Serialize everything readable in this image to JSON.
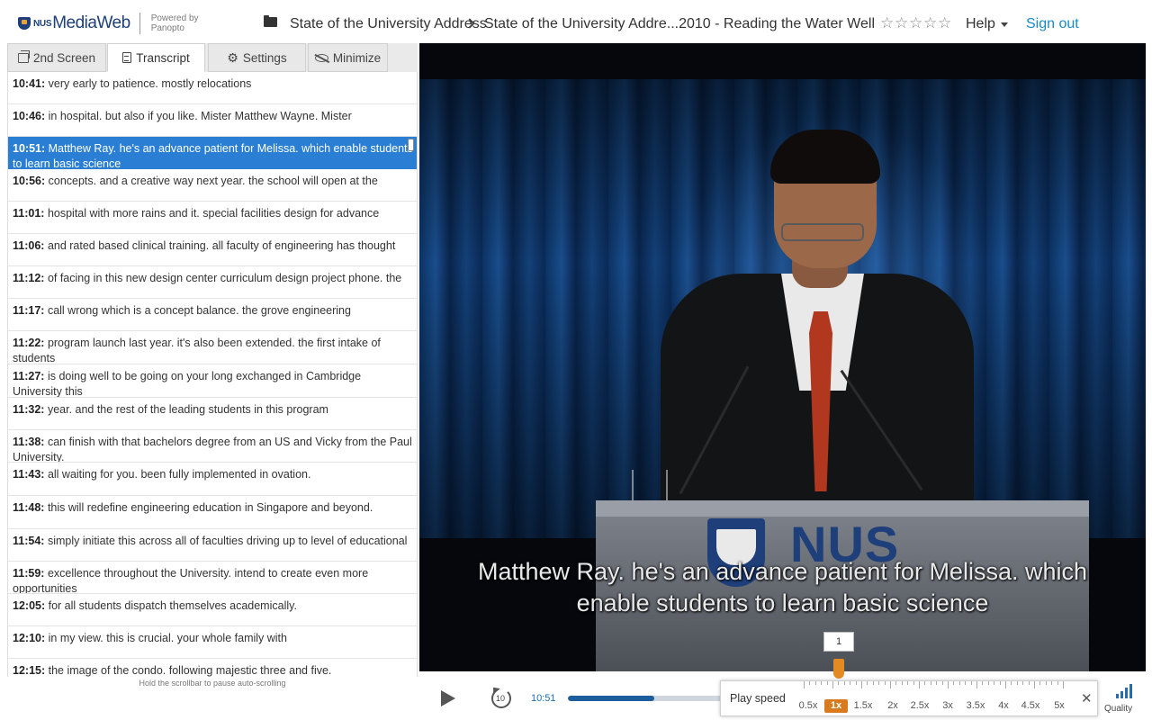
{
  "header": {
    "logo_prefix": "NUS",
    "logo_name": "MediaWeb",
    "powered_line1": "Powered by",
    "powered_line2": "Panopto",
    "breadcrumb_folder": "State of the University Address",
    "breadcrumb_session": "State of the University Addre...2010 - Reading the Water Well",
    "rating_stars": [
      "☆",
      "☆",
      "☆",
      "☆",
      "☆"
    ],
    "help_label": "Help",
    "signout_label": "Sign out",
    "accent_color": "#1a8ac7"
  },
  "tabs": [
    {
      "label": "2nd Screen",
      "icon": "second-screen-icon"
    },
    {
      "label": "Transcript",
      "icon": "document-icon"
    },
    {
      "label": "Settings",
      "icon": "gear-icon"
    },
    {
      "label": "Minimize",
      "icon": "eye-off-icon"
    }
  ],
  "transcript": {
    "lines": [
      {
        "time": "10:41:",
        "text": "very early to patience. mostly relocations"
      },
      {
        "time": "10:46:",
        "text": "in hospital. but also if you like. Mister Matthew Wayne. Mister"
      },
      {
        "time": "10:51:",
        "text": "Matthew Ray. he's an advance patient for Melissa. which enable students to learn basic science",
        "active": true
      },
      {
        "time": "10:56:",
        "text": "concepts. and a creative way next year. the school will open at the"
      },
      {
        "time": "11:01:",
        "text": "hospital with more rains and it. special facilities design for advance"
      },
      {
        "time": "11:06:",
        "text": "and rated based clinical training. all faculty of engineering has thought"
      },
      {
        "time": "11:12:",
        "text": "of facing in this new design center curriculum design project phone. the"
      },
      {
        "time": "11:17:",
        "text": "call wrong which is a concept balance. the grove engineering"
      },
      {
        "time": "11:22:",
        "text": "program launch last year. it's also been extended. the first intake of students"
      },
      {
        "time": "11:27:",
        "text": "is doing well to be going on your long exchanged in Cambridge University this"
      },
      {
        "time": "11:32:",
        "text": "year. and the rest of the leading students in this program"
      },
      {
        "time": "11:38:",
        "text": "can finish with that bachelors degree from an US and Vicky from the Paul University."
      },
      {
        "time": "11:43:",
        "text": "all waiting for you. been fully implemented in ovation."
      },
      {
        "time": "11:48:",
        "text": "this will redefine engineering education in Singapore and beyond."
      },
      {
        "time": "11:54:",
        "text": "simply initiate this across all of faculties driving up to level of educational"
      },
      {
        "time": "11:59:",
        "text": "excellence throughout the University. intend to create even more opportunities"
      },
      {
        "time": "12:05:",
        "text": "for all students dispatch themselves academically."
      },
      {
        "time": "12:10:",
        "text": "in my view. this is crucial. your whole family with"
      },
      {
        "time": "12:15:",
        "text": "the image of the condo. following majestic three and five."
      }
    ],
    "hint": "Hold the scrollbar to pause auto-scrolling",
    "highlight_color": "#2a7fd4"
  },
  "video": {
    "caption_line1": "Matthew Ray. he's an advance patient for Melissa. which",
    "caption_line2": "enable students to learn basic science",
    "podium_text": "NUS"
  },
  "controls": {
    "current_time": "10:51",
    "progress_percent": 55,
    "play_speed_label": "Play speed",
    "speed_options": [
      "0.5x",
      "1x",
      "1.5x",
      "2x",
      "2.5x",
      "3x",
      "3.5x",
      "4x",
      "4.5x",
      "5x"
    ],
    "selected_speed": "1x",
    "speed_tooltip": "1",
    "rewind_seconds": "10",
    "close_symbol": "✕",
    "quality_label": "Quality",
    "speed_accent": "#d87b1e"
  }
}
